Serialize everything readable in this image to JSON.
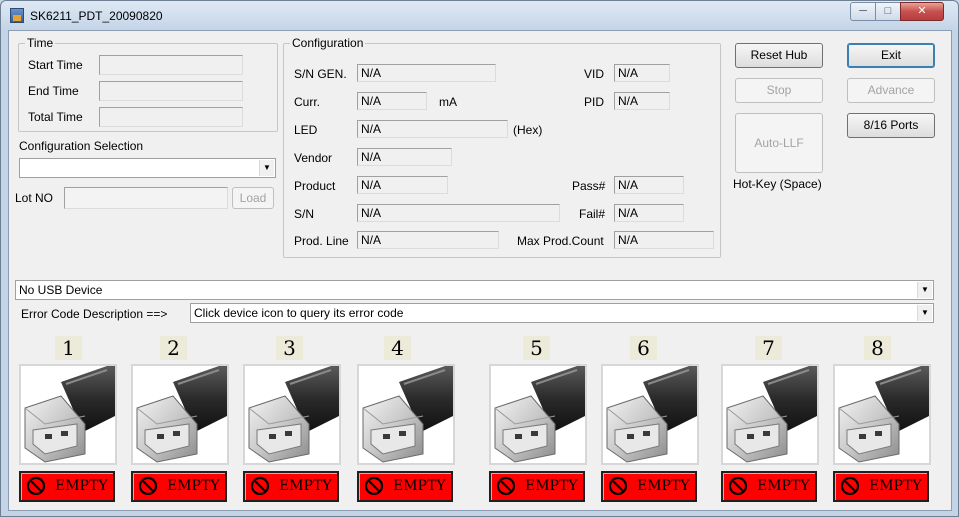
{
  "window": {
    "title": "SK6211_PDT_20090820",
    "minimize_label": "─",
    "maximize_label": "□",
    "close_label": "✕"
  },
  "time_group": {
    "title": "Time",
    "start_label": "Start Time",
    "end_label": "End Time",
    "total_label": "Total Time",
    "start_value": "",
    "end_value": "",
    "total_value": ""
  },
  "config_selection": {
    "label": "Configuration Selection",
    "value": ""
  },
  "lot": {
    "label": "Lot NO",
    "value": "",
    "load_label": "Load"
  },
  "configuration": {
    "title": "Configuration",
    "sn_gen_label": "S/N GEN.",
    "sn_gen_value": "N/A",
    "curr_label": "Curr.",
    "curr_value": "N/A",
    "curr_unit": "mA",
    "led_label": "LED",
    "led_value": "N/A",
    "led_unit": "(Hex)",
    "vendor_label": "Vendor",
    "vendor_value": "N/A",
    "product_label": "Product",
    "product_value": "N/A",
    "sn_label": "S/N",
    "sn_value": "N/A",
    "prod_line_label": "Prod. Line",
    "prod_line_value": "N/A",
    "vid_label": "VID",
    "vid_value": "N/A",
    "pid_label": "PID",
    "pid_value": "N/A",
    "pass_label": "Pass#",
    "pass_value": "N/A",
    "fail_label": "Fail#",
    "fail_value": "N/A",
    "max_prod_label": "Max Prod.Count",
    "max_prod_value": "N/A"
  },
  "buttons": {
    "reset_hub": "Reset Hub",
    "stop": "Stop",
    "auto_llf": "Auto-LLF",
    "hotkey": "Hot-Key (Space)",
    "exit": "Exit",
    "advance": "Advance",
    "ports": "8/16 Ports"
  },
  "usb_device": {
    "value": "No USB Device"
  },
  "error_code": {
    "label": "Error Code Description ==>",
    "value": "Click device icon to query its error code"
  },
  "slots": [
    {
      "num": "1",
      "status": "EMPTY"
    },
    {
      "num": "2",
      "status": "EMPTY"
    },
    {
      "num": "3",
      "status": "EMPTY"
    },
    {
      "num": "4",
      "status": "EMPTY"
    },
    {
      "num": "5",
      "status": "EMPTY"
    },
    {
      "num": "6",
      "status": "EMPTY"
    },
    {
      "num": "7",
      "status": "EMPTY"
    },
    {
      "num": "8",
      "status": "EMPTY"
    }
  ],
  "colors": {
    "status_empty": "#ff0000",
    "number_bg": "#ecead9"
  },
  "icons": {
    "slot_image": "usb-flash-drive-icon",
    "status_icon": "no-entry-icon"
  }
}
